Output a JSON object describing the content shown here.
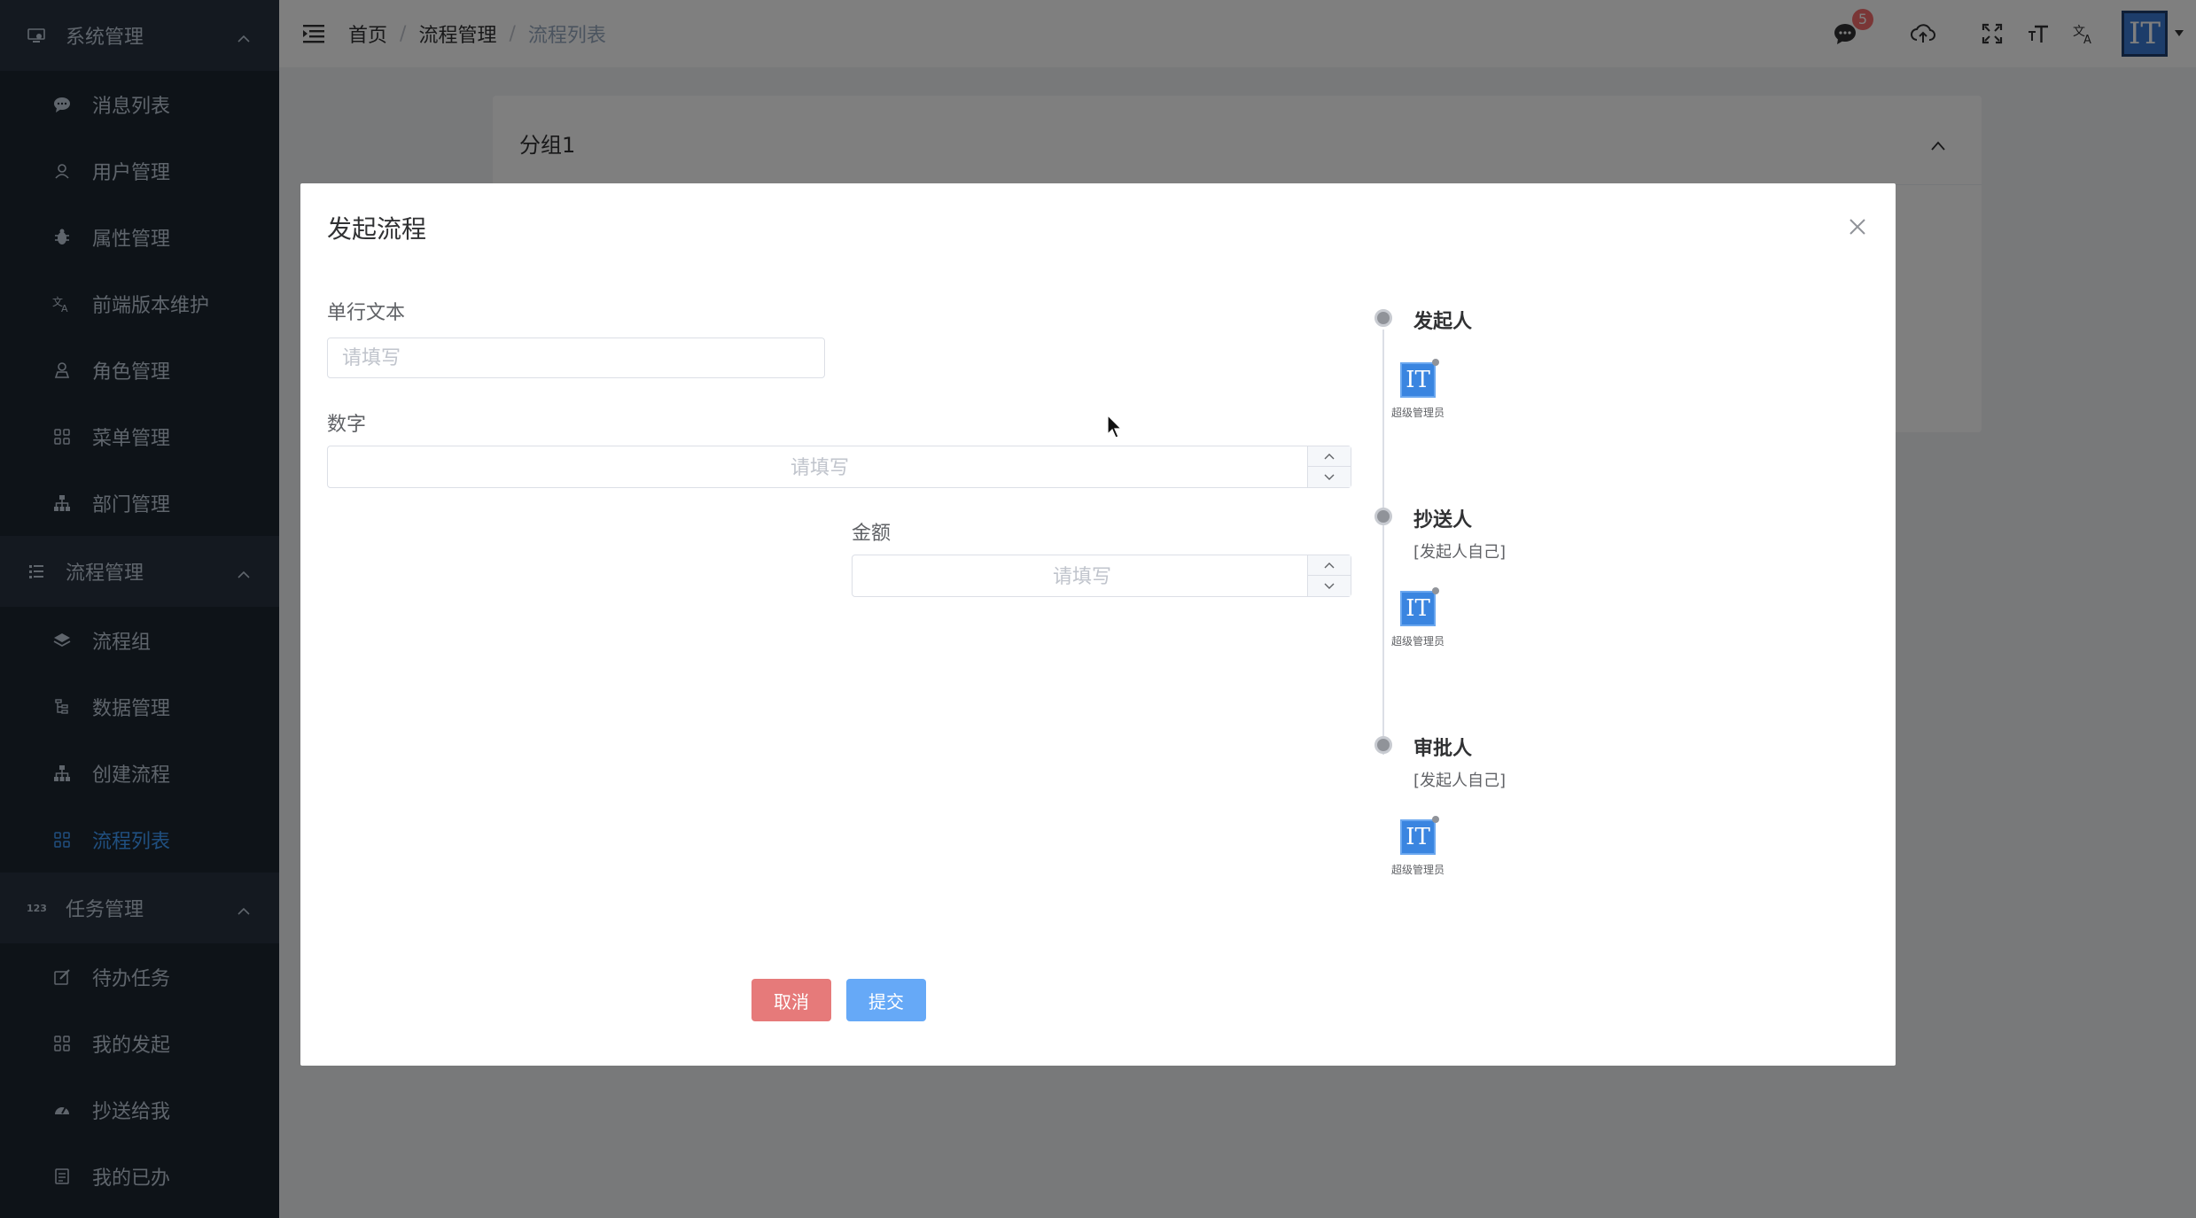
{
  "sidebar": {
    "groups": [
      {
        "label": "系统管理",
        "icon": "monitor-icon",
        "items": [
          {
            "label": "消息列表",
            "icon": "chat-icon"
          },
          {
            "label": "用户管理",
            "icon": "user-icon"
          },
          {
            "label": "属性管理",
            "icon": "bug-icon"
          },
          {
            "label": "前端版本维护",
            "icon": "translate-icon"
          },
          {
            "label": "角色管理",
            "icon": "role-icon"
          },
          {
            "label": "菜单管理",
            "icon": "grid-icon"
          },
          {
            "label": "部门管理",
            "icon": "tree-icon"
          }
        ]
      },
      {
        "label": "流程管理",
        "icon": "list-icon",
        "items": [
          {
            "label": "流程组",
            "icon": "layers-icon"
          },
          {
            "label": "数据管理",
            "icon": "tree-list-icon"
          },
          {
            "label": "创建流程",
            "icon": "tree-icon"
          },
          {
            "label": "流程列表",
            "icon": "grid-icon",
            "active": true
          }
        ]
      },
      {
        "label": "任务管理",
        "icon": "number-icon",
        "items": [
          {
            "label": "待办任务",
            "icon": "edit-icon"
          },
          {
            "label": "我的发起",
            "icon": "grid-icon"
          },
          {
            "label": "抄送给我",
            "icon": "dashboard-icon"
          },
          {
            "label": "我的已办",
            "icon": "doc-icon"
          }
        ]
      }
    ]
  },
  "navbar": {
    "breadcrumb": [
      "首页",
      "流程管理",
      "流程列表"
    ],
    "message_count": "5",
    "avatar_text": "IT"
  },
  "background_card": {
    "title": "分组1"
  },
  "dialog": {
    "title": "发起流程",
    "fields": {
      "text": {
        "label": "单行文本",
        "placeholder": "请填写"
      },
      "number": {
        "label": "数字",
        "placeholder": "请填写"
      },
      "amount": {
        "label": "金额",
        "placeholder": "请填写"
      }
    },
    "buttons": {
      "cancel": "取消",
      "submit": "提交"
    },
    "timeline": [
      {
        "title": "发起人",
        "subtitle": "",
        "user": {
          "avatar": "IT",
          "name": "超级管理员"
        }
      },
      {
        "title": "抄送人",
        "subtitle": "[发起人自己]",
        "user": {
          "avatar": "IT",
          "name": "超级管理员"
        }
      },
      {
        "title": "审批人",
        "subtitle": "[发起人自己]",
        "user": {
          "avatar": "IT",
          "name": "超级管理员"
        }
      }
    ]
  },
  "colors": {
    "sidebar_bg": "#1c2631",
    "active": "#409eff",
    "cancel": "#e67a7a",
    "submit": "#66a9f7"
  }
}
